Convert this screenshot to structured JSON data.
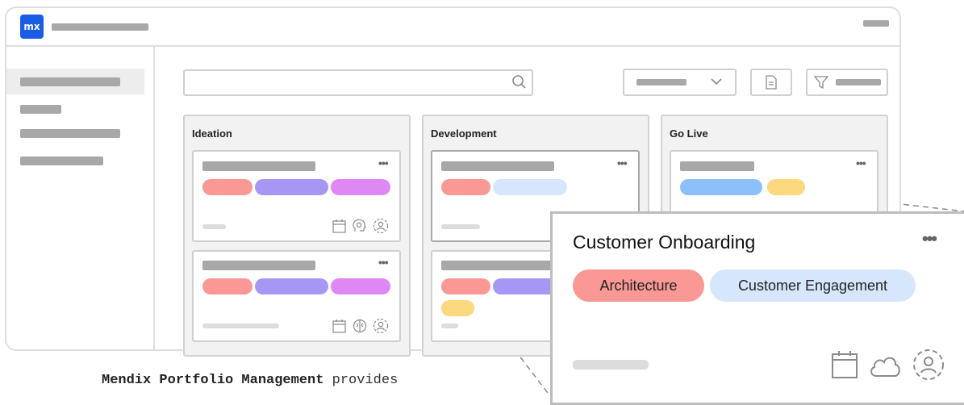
{
  "app": {
    "logo_text": "mx"
  },
  "columns": [
    {
      "title": "Ideation"
    },
    {
      "title": "Development"
    },
    {
      "title": "Go Live"
    }
  ],
  "card_menu_glyph": "•••",
  "callout": {
    "title": "Customer Onboarding",
    "tags": [
      "Architecture",
      "Customer Engagement"
    ],
    "menu_glyph": "•••"
  },
  "caption": {
    "bold": "Mendix Portfolio Management",
    "rest": " provides"
  },
  "colors": {
    "accent": "#1a5ce5",
    "tag_red": "#f99894",
    "tag_purple": "#a896f5",
    "tag_pink": "#df87f3",
    "tag_lightblue": "#d6e6fb",
    "tag_blue": "#8cc0fb",
    "tag_yellow": "#fcd87e"
  }
}
